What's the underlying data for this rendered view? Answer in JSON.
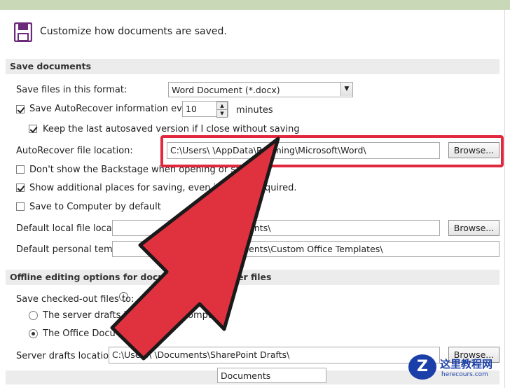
{
  "header": {
    "title": "Customize how documents are saved."
  },
  "icons": {
    "save": "floppy-disk-icon",
    "info": "info-icon",
    "arrow": "red-arrow-annotation",
    "select_arrow": "dropdown-arrow-icon"
  },
  "colors": {
    "highlight": "#e2283f",
    "arrow": "#e0313f",
    "section_bg": "#ececec",
    "floppy": "#6b2a7a"
  },
  "save_documents": {
    "section_label": "Save documents",
    "format_label": "Save files in this format:",
    "format_value": "Word Document (*.docx)",
    "autorecover_label": "Save AutoRecover information every",
    "autorecover_minutes": "10",
    "minutes_label": "minutes",
    "keep_last_label": "Keep the last autosaved version if I close without saving",
    "autorecover_location_label": "AutoRecover file location:",
    "autorecover_location_value": "C:\\Users\\     \\AppData\\Roaming\\Microsoft\\Word\\",
    "browse_label": "Browse...",
    "backstage_label": "Don't show the Backstage when opening or saving",
    "additional_places_label": "Show additional places for saving, even if",
    "additional_places_tail": "quired.",
    "save_computer_label": "Save to Computer by default",
    "default_local_label": "Default local file location",
    "default_local_value": "ments\\",
    "default_personal_label": "Default personal templates",
    "default_personal_value": "ments\\Custom Office Templates\\"
  },
  "offline": {
    "section_label": "Offline editing options for docu",
    "section_tail": "er files",
    "checked_out_label": "Save checked-out files to:",
    "server_drafts_radio": "The server drafts lo",
    "server_drafts_tail": "s compu",
    "office_cache_radio": "The Office Docu",
    "server_drafts_location_label": "Server drafts location:",
    "server_drafts_location_value": "C:\\Users\\          \\Documents\\SharePoint Drafts\\"
  },
  "bottom_partial": {
    "dropdown_value": "Documents"
  },
  "watermark": {
    "logo_letter": "Z",
    "cn_text": "这里教程网",
    "site": "herecours.com"
  }
}
